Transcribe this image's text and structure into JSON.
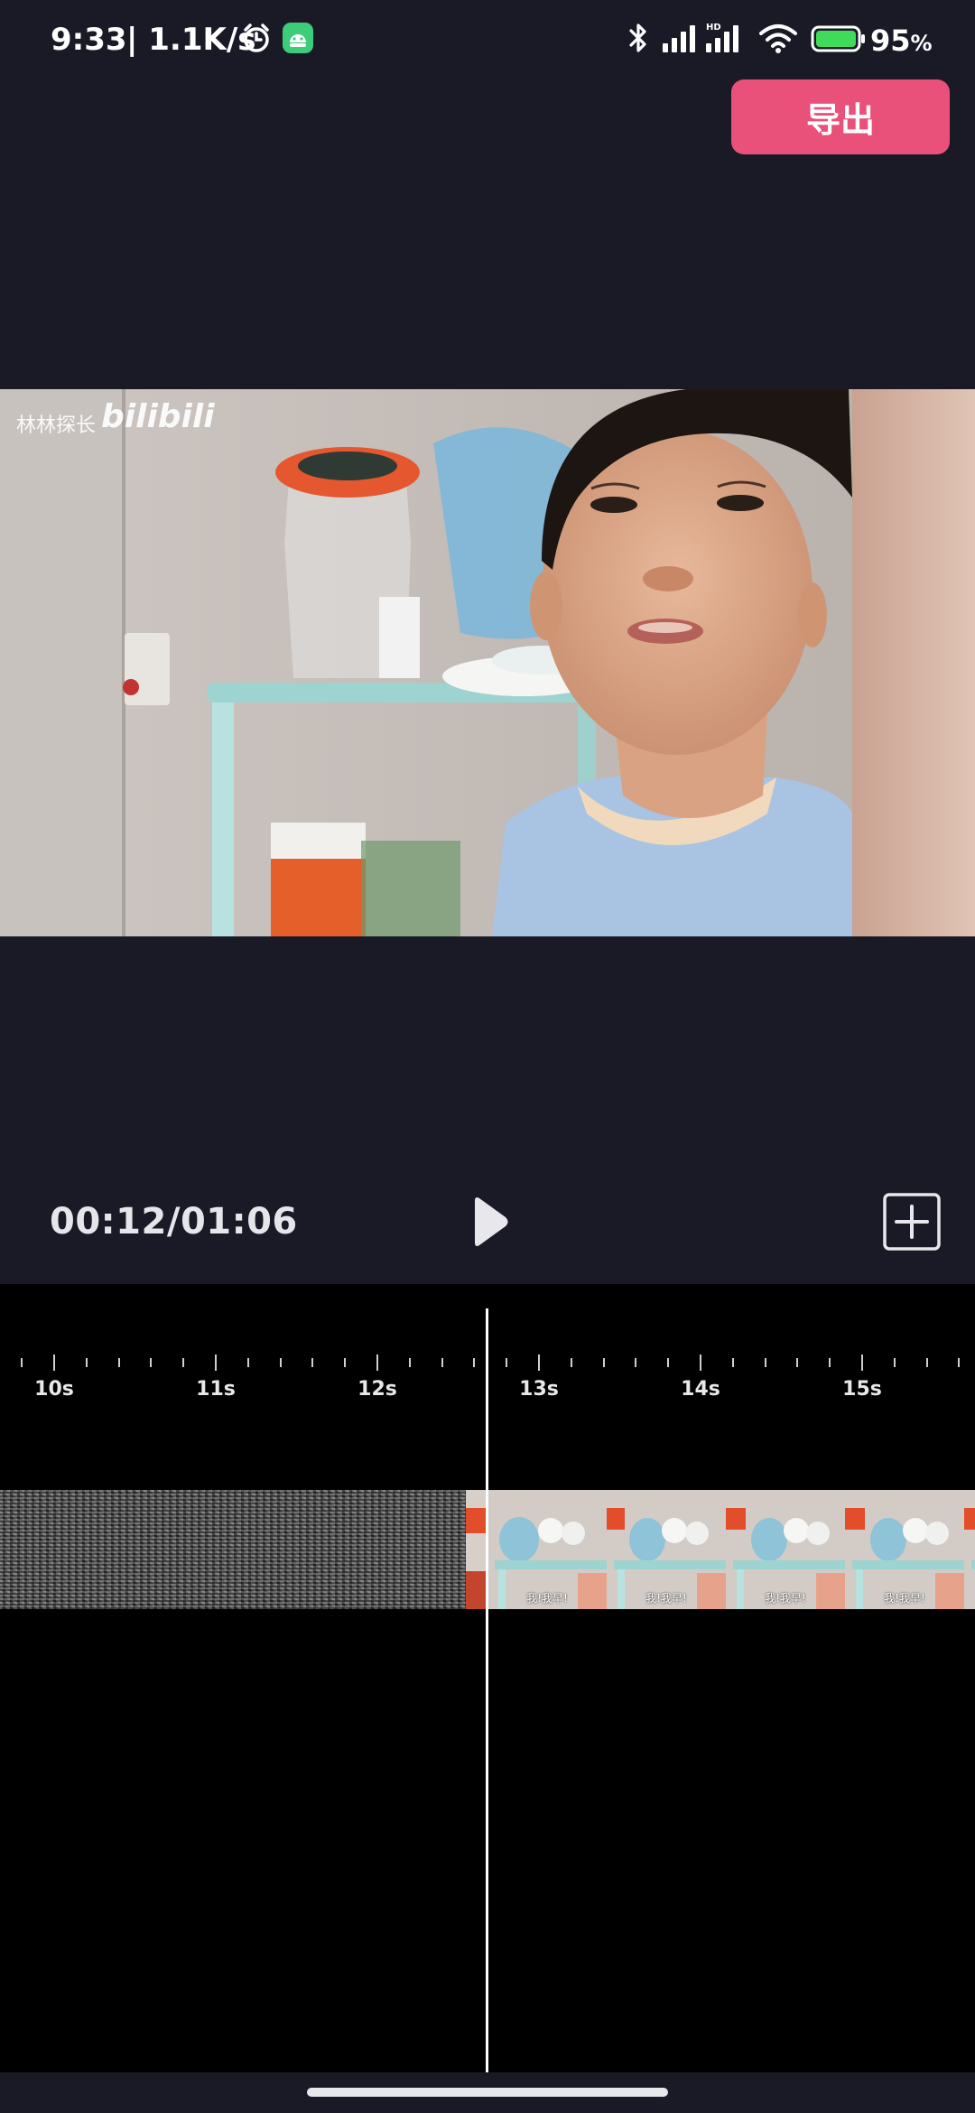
{
  "status_bar": {
    "time": "9:33",
    "network_speed": "| 1.1K/s",
    "battery_level": "95",
    "battery_percent_sign": "%",
    "icons": [
      "alarm-icon",
      "android-app-icon",
      "bluetooth-icon",
      "signal-icon",
      "hd-signal-icon",
      "wifi-icon",
      "battery-icon"
    ]
  },
  "toolbar": {
    "export_label": "导出",
    "export_color": "#e9517a"
  },
  "preview": {
    "watermark_text": "林林探长",
    "watermark_logo": "bilibili"
  },
  "playback": {
    "current_time": "00:12",
    "separator": "/",
    "total_time": "01:06",
    "play_icon": "play-icon",
    "add_icon": "add-clip-icon"
  },
  "timeline": {
    "ticks": [
      "10s",
      "11s",
      "12s",
      "13s",
      "14s",
      "15s"
    ],
    "clip_caption": "我!我早!"
  },
  "colors": {
    "background": "#191a26",
    "timeline_background": "#000000",
    "accent": "#e9517a"
  }
}
